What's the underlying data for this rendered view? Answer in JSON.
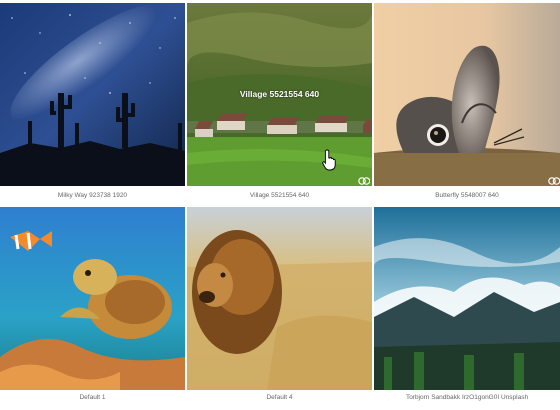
{
  "gallery": {
    "items": [
      {
        "caption": "Milky Way 923738 1920"
      },
      {
        "caption": "Village 5521554 640",
        "hover_title": "Village 5521554 640"
      },
      {
        "caption": "Butterfly 5548007 640"
      },
      {
        "caption": "Default 1"
      },
      {
        "caption": "Default 4"
      },
      {
        "caption": "Torbjorn Sandbakk IrzO1gonG0I Unsplash"
      }
    ]
  }
}
